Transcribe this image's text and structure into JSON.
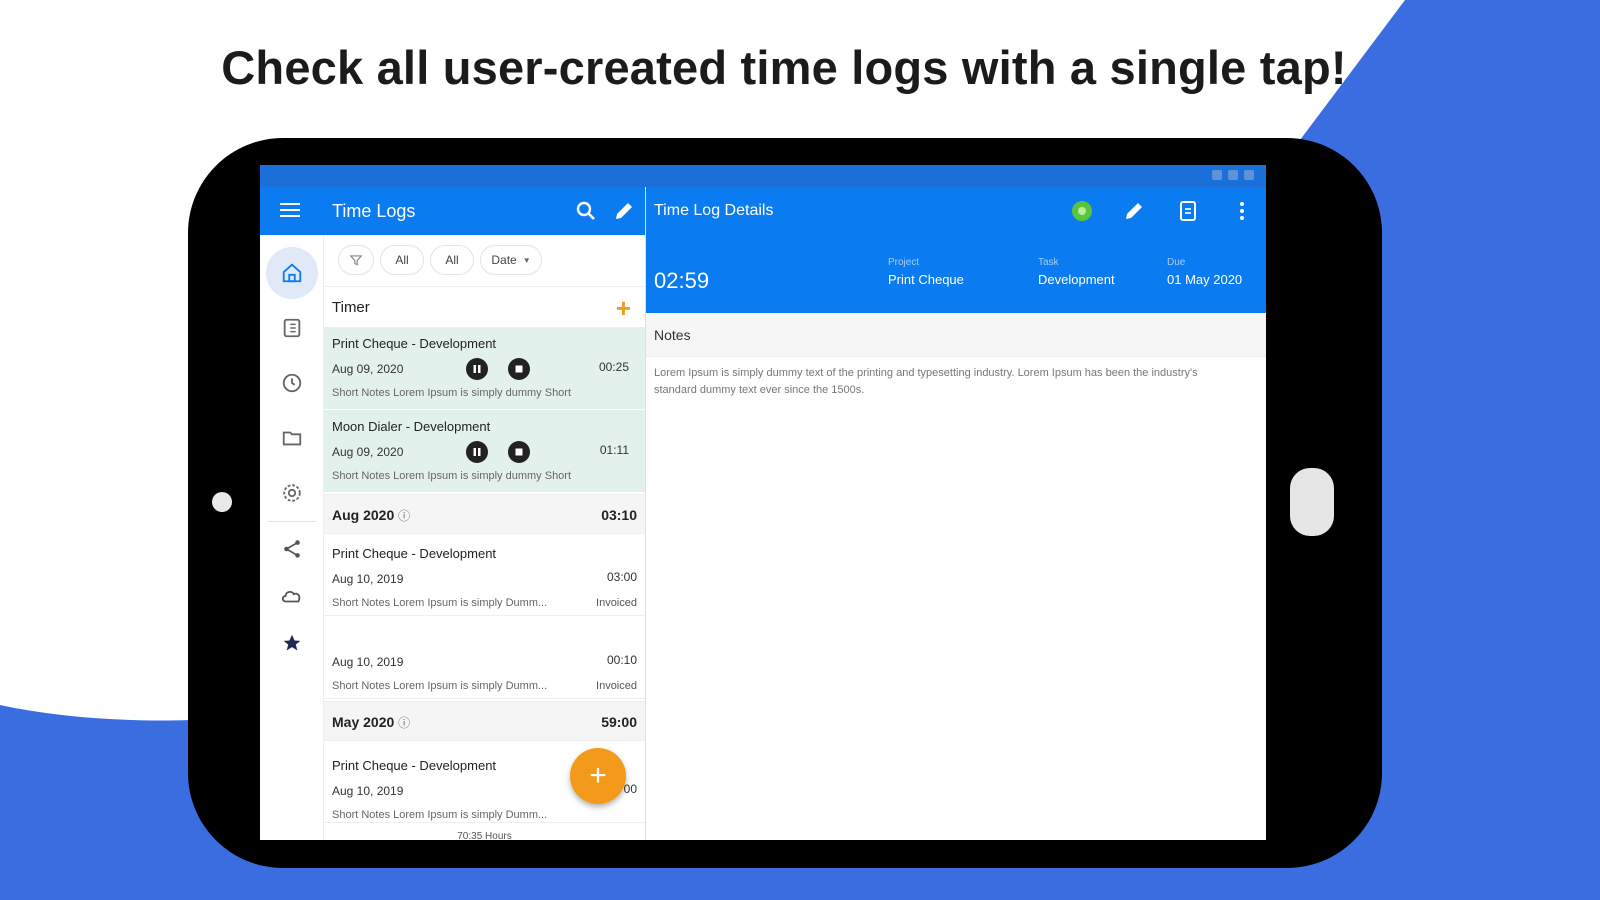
{
  "headline": "Check all user-created time logs with a single tap!",
  "colors": {
    "brand_blue": "#0a7bf0",
    "background_blue": "#3a6ee0",
    "accent_orange": "#f49a1b",
    "running_green_bg": "#e3f1ec",
    "status_green": "#5ac43a"
  },
  "list_appbar": {
    "title": "Time Logs",
    "menu_icon": "menu-icon",
    "search_icon": "search-icon",
    "edit_icon": "pencil-icon"
  },
  "detail_appbar": {
    "title": "Time Log Details",
    "icons": [
      "status-dot-icon",
      "pencil-icon",
      "document-icon",
      "more-vert-icon"
    ]
  },
  "nav_rail": [
    "home-icon",
    "reports-icon",
    "clock-icon",
    "folder-icon",
    "settings-icon",
    "share-icon",
    "cloud-icon",
    "star-icon"
  ],
  "filters": {
    "chip1": "All",
    "chip2": "All",
    "sort": "Date"
  },
  "timer": {
    "label": "Timer",
    "running": [
      {
        "title": "Print Cheque - Development",
        "date": "Aug 09, 2020",
        "time": "00:25",
        "notes": "Short Notes Lorem Ipsum is simply dummy Short"
      },
      {
        "title": "Moon Dialer - Development",
        "date": "Aug 09, 2020",
        "time": "01:11",
        "notes": "Short Notes Lorem Ipsum is simply dummy Short"
      }
    ]
  },
  "groups": [
    {
      "title": "Aug 2020",
      "total": "03:10",
      "entries": [
        {
          "title": "Print Cheque - Development",
          "date": "Aug 10, 2019",
          "time": "03:00",
          "notes": "Short Notes Lorem Ipsum is simply Dumm...",
          "status": "Invoiced"
        },
        {
          "title": "",
          "date": "Aug 10, 2019",
          "time": "00:10",
          "notes": "Short Notes Lorem Ipsum is simply Dumm...",
          "status": "Invoiced"
        }
      ]
    },
    {
      "title": "May 2020",
      "total": "59:00",
      "entries": [
        {
          "title": "Print Cheque - Development",
          "date": "Aug 10, 2019",
          "time": "00",
          "notes": "Short Notes Lorem Ipsum is simply Dumm...",
          "status": ""
        }
      ]
    }
  ],
  "list_footer": "70:35 Hours",
  "detail": {
    "elapsed": "02:59",
    "project_label": "Project",
    "project_value": "Print Cheque",
    "task_label": "Task",
    "task_value": "Development",
    "due_label": "Due",
    "due_value": "01 May 2020",
    "notes_label": "Notes",
    "notes_text": "Lorem Ipsum is simply dummy text of the printing and typesetting industry. Lorem Ipsum has been the industry's standard dummy text ever since the 1500s."
  }
}
